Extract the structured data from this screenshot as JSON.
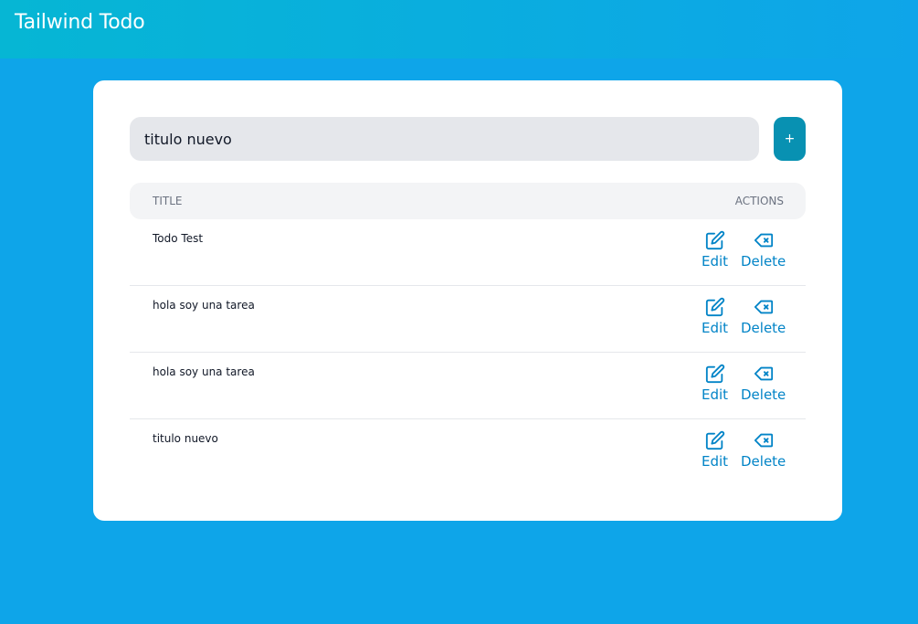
{
  "app": {
    "brand": "Tailwind Todo"
  },
  "form": {
    "input_value": "titulo nuevo",
    "add_label": "+"
  },
  "table": {
    "headers": {
      "title": "TITLE",
      "actions": "ACTIONS"
    },
    "rows": [
      {
        "title": "Todo Test",
        "edit_label": "Edit",
        "delete_label": "Delete"
      },
      {
        "title": "hola soy una tarea",
        "edit_label": "Edit",
        "delete_label": "Delete"
      },
      {
        "title": "hola soy una tarea",
        "edit_label": "Edit",
        "delete_label": "Delete"
      },
      {
        "title": "titulo nuevo",
        "edit_label": "Edit",
        "delete_label": "Delete"
      }
    ]
  },
  "icons": {
    "edit": "pencil-square-icon",
    "delete": "backspace-x-icon"
  },
  "colors": {
    "page_background": "#0ea5e9",
    "navbar_gradient_start": "#06b6d4",
    "navbar_gradient_end": "#0ea5e9",
    "add_button": "#0891b2",
    "action_text": "#0284c7"
  }
}
